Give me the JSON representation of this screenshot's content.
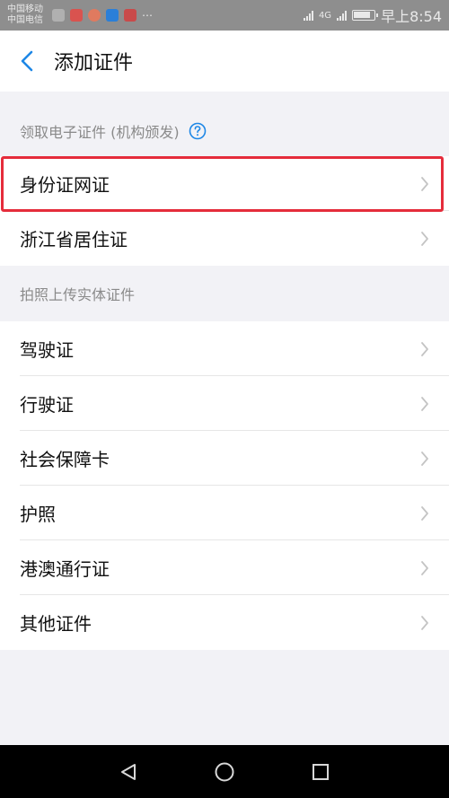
{
  "status_bar": {
    "carrier_top": "中国移动",
    "carrier_bottom": "中国电信",
    "network": "4G",
    "time": "早上8:54"
  },
  "nav": {
    "title": "添加证件"
  },
  "section_official": {
    "title": "领取电子证件 (机构颁发)",
    "items": [
      {
        "label": "身份证网证"
      },
      {
        "label": "浙江省居住证"
      }
    ]
  },
  "section_upload": {
    "title": "拍照上传实体证件",
    "items": [
      {
        "label": "驾驶证"
      },
      {
        "label": "行驶证"
      },
      {
        "label": "社会保障卡"
      },
      {
        "label": "护照"
      },
      {
        "label": "港澳通行证"
      },
      {
        "label": "其他证件"
      }
    ]
  },
  "colors": {
    "accent": "#1e87e6",
    "highlight": "#e52c3b",
    "page_bg": "#f2f2f6"
  }
}
